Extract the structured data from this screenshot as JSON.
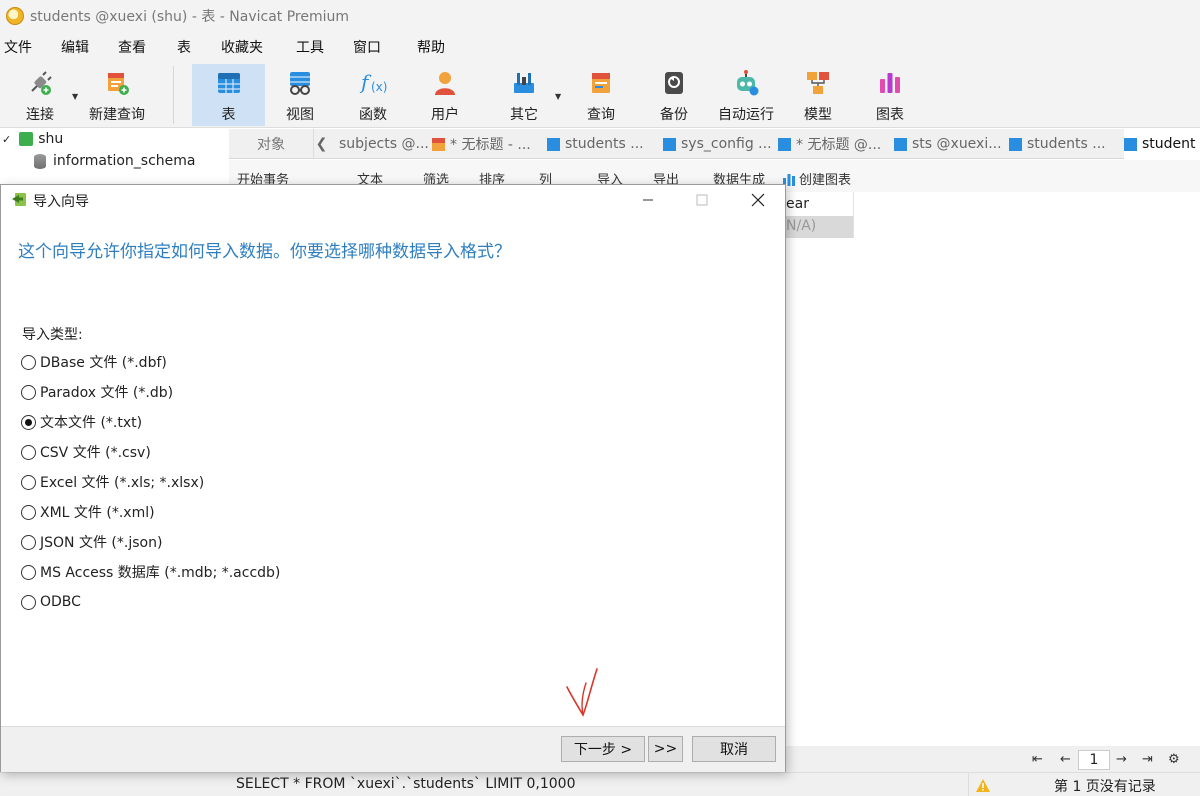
{
  "window": {
    "title": "students @xuexi (shu) - 表 - Navicat Premium"
  },
  "menu": [
    "文件",
    "编辑",
    "查看",
    "表",
    "收藏夹",
    "工具",
    "窗口",
    "帮助"
  ],
  "toolbar": {
    "connect": "连接",
    "new_query": "新建查询",
    "table": "表",
    "view": "视图",
    "function": "函数",
    "user": "用户",
    "other": "其它",
    "query": "查询",
    "backup": "备份",
    "automation": "自动运行",
    "model": "模型",
    "chart": "图表"
  },
  "tree": {
    "connection": "shu",
    "db1": "information_schema"
  },
  "tabs": {
    "objects": "对象",
    "items": [
      "subjects @...",
      "* 无标题 - ...",
      "students ...",
      "sys_config ...",
      "* 无标题 @...",
      "sts @xuexi...",
      "students ...",
      "student"
    ]
  },
  "subtoolbar": {
    "begin_transaction": "开始事务",
    "text": "文本",
    "filter": "筛选",
    "sort": "排序",
    "columns": "列",
    "import": "导入",
    "export": "导出",
    "generate_data": "数据生成",
    "create_chart": "创建图表"
  },
  "grid": {
    "header": "ear",
    "cell": "N/A)"
  },
  "dialog": {
    "title": "导入向导",
    "question": "这个向导允许你指定如何导入数据。你要选择哪种数据导入格式？",
    "import_type_label": "导入类型:",
    "options": [
      "DBase 文件 (*.dbf)",
      "Paradox 文件 (*.db)",
      "文本文件 (*.txt)",
      "CSV 文件 (*.csv)",
      "Excel 文件 (*.xls; *.xlsx)",
      "XML 文件 (*.xml)",
      "JSON 文件 (*.json)",
      "MS Access 数据库 (*.mdb; *.accdb)",
      "ODBC"
    ],
    "selected_option": "文本文件 (*.txt)",
    "next_button": "下一步 >",
    "last_button": ">>",
    "cancel_button": "取消"
  },
  "nav": {
    "page": "1"
  },
  "status": {
    "sql": "SELECT * FROM `xuexi`.`students` LIMIT 0,1000",
    "pages": "第 1 页没有记录"
  },
  "colors": {
    "accent_blue": "#2f7fc0",
    "active_toolbar": "#cfe2f5",
    "annotation_red": "#d9362b"
  }
}
